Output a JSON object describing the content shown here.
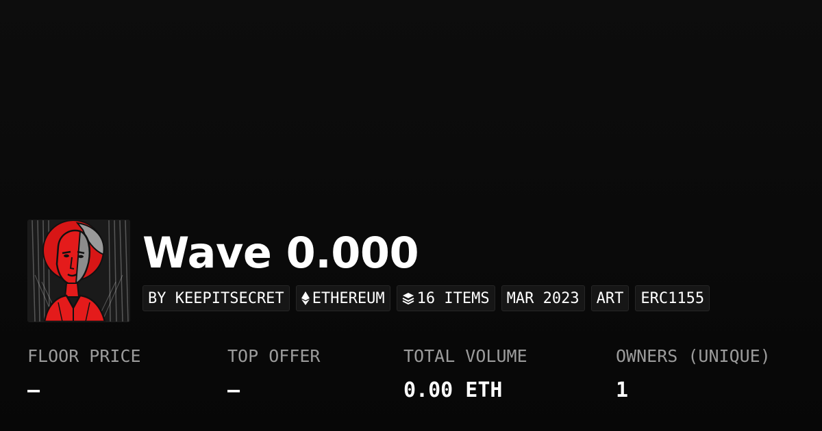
{
  "collection": {
    "title": "Wave 0.000",
    "tags": {
      "creator": "BY KEEPITSECRET",
      "chain": "ETHEREUM",
      "items": "16 ITEMS",
      "date": "MAR 2023",
      "category": "ART",
      "standard": "ERC1155"
    },
    "tag_icons": {
      "chain": "ethereum-icon",
      "items": "layers-icon"
    }
  },
  "stats": [
    {
      "label": "FLOOR PRICE",
      "value": "–"
    },
    {
      "label": "TOP OFFER",
      "value": "–"
    },
    {
      "label": "TOTAL VOLUME",
      "value": "0.00 ETH"
    },
    {
      "label": "OWNERS (UNIQUE)",
      "value": "1"
    }
  ],
  "colors": {
    "background": "#0a0a0a",
    "accent_red": "#e01818",
    "label_gray": "#9b9b9b",
    "tag_background": "#161616"
  }
}
